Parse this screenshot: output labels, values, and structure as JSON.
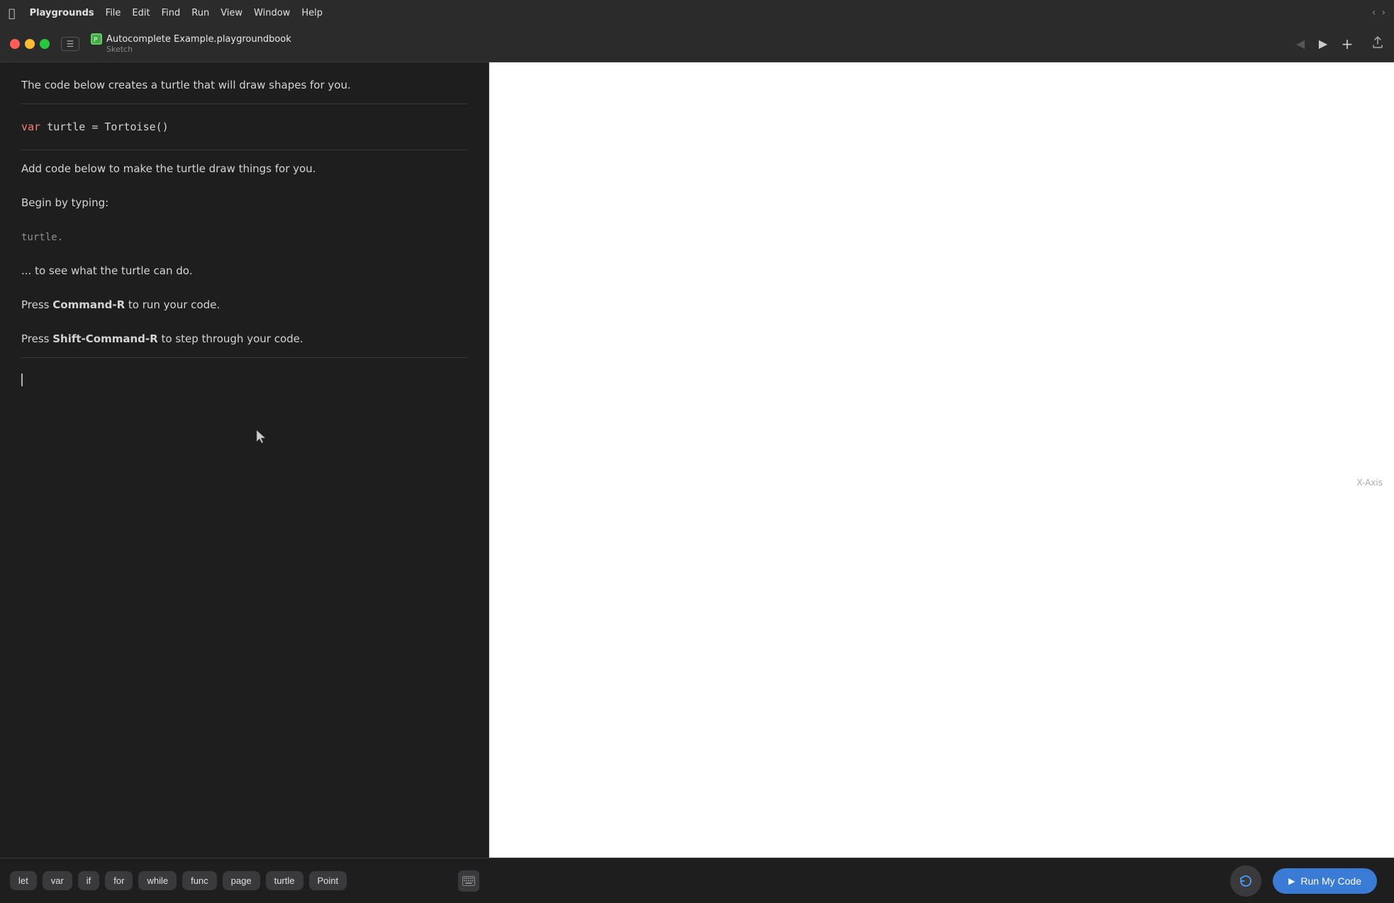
{
  "menubar": {
    "apple": "",
    "items": [
      "Playgrounds",
      "File",
      "Edit",
      "Find",
      "Run",
      "View",
      "Window",
      "Help"
    ]
  },
  "titlebar": {
    "filename": "Autocomplete Example.playgroundbook",
    "subtitle": "Sketch",
    "file_icon": "📗"
  },
  "editor": {
    "prose1": "The code below creates a turtle that will draw shapes for you.",
    "code_line": "var turtle = Tortoise()",
    "prose2": "Add code below to make the turtle draw things for you.",
    "prose3": "Begin by typing:",
    "code_inline": "turtle.",
    "prose4": "... to see what the turtle can do.",
    "prose5_prefix": "Press ",
    "prose5_bold": "Command-R",
    "prose5_suffix": " to run your code.",
    "prose6_prefix": "Press ",
    "prose6_bold": "Shift-Command-R",
    "prose6_suffix": " to step through your code."
  },
  "snippets": {
    "buttons": [
      "let",
      "var",
      "if",
      "for",
      "while",
      "func",
      "page",
      "turtle",
      "Point"
    ]
  },
  "run_area": {
    "run_label": "Run My Code",
    "x_axis_label": "X-Axis"
  },
  "nav": {
    "back_disabled": true,
    "forward_disabled": false
  }
}
